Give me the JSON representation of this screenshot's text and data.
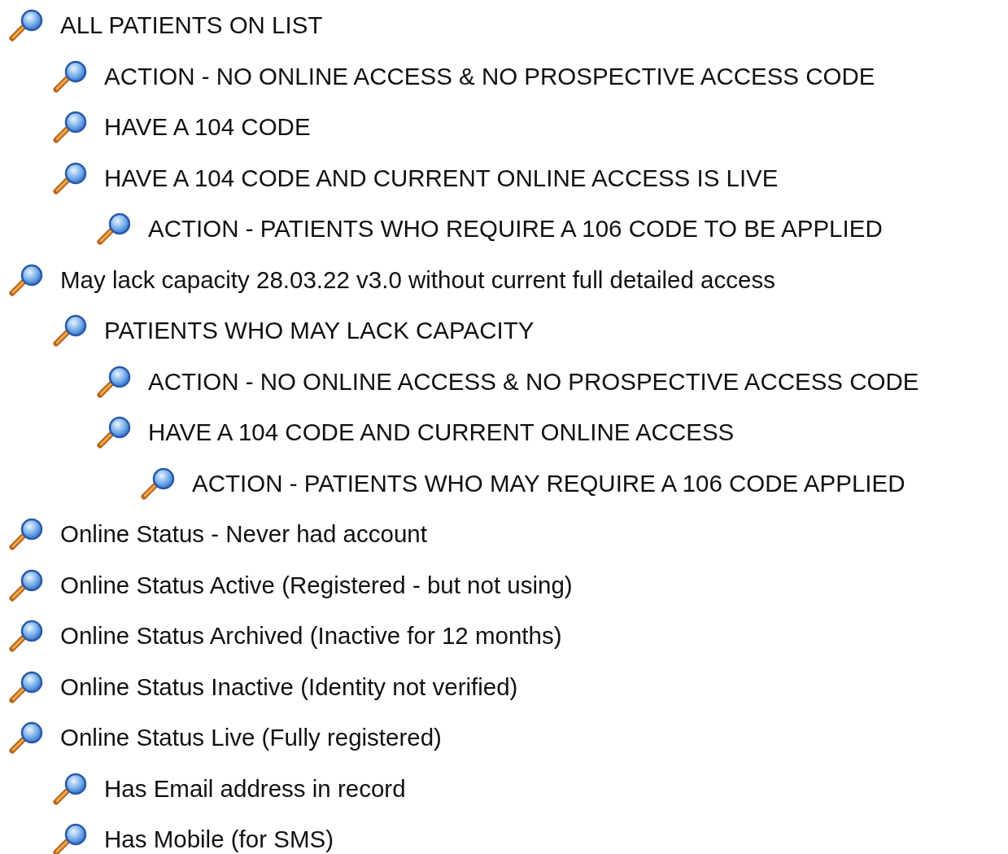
{
  "tree": [
    {
      "label": "ALL PATIENTS ON LIST",
      "children": [
        {
          "label": "ACTION - NO ONLINE ACCESS & NO PROSPECTIVE ACCESS CODE"
        },
        {
          "label": "HAVE A 104 CODE"
        },
        {
          "label": "HAVE A 104 CODE AND CURRENT ONLINE ACCESS IS LIVE",
          "children": [
            {
              "label": "ACTION - PATIENTS WHO REQUIRE A 106 CODE TO BE APPLIED"
            }
          ]
        }
      ]
    },
    {
      "label": "May lack capacity 28.03.22 v3.0 without current full detailed access",
      "children": [
        {
          "label": "PATIENTS WHO MAY LACK CAPACITY",
          "children": [
            {
              "label": "ACTION - NO ONLINE ACCESS & NO PROSPECTIVE ACCESS CODE"
            },
            {
              "label": "HAVE A 104 CODE AND CURRENT ONLINE ACCESS",
              "children": [
                {
                  "label": "ACTION - PATIENTS WHO MAY REQUIRE A 106 CODE APPLIED"
                }
              ]
            }
          ]
        }
      ]
    },
    {
      "label": "Online Status - Never had account"
    },
    {
      "label": "Online Status Active (Registered - but not using)"
    },
    {
      "label": "Online Status Archived (Inactive for 12 months)"
    },
    {
      "label": "Online Status Inactive (Identity not verified)"
    },
    {
      "label": "Online Status Live (Fully registered)",
      "children": [
        {
          "label": "Has Email address in record"
        },
        {
          "label": "Has Mobile (for SMS)"
        }
      ]
    }
  ]
}
